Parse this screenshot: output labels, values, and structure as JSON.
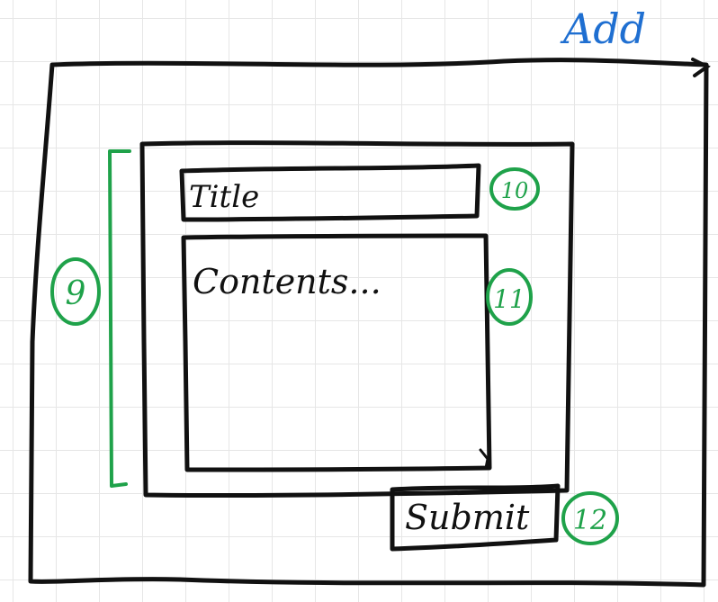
{
  "heading": "Add",
  "form": {
    "title_placeholder": "Title",
    "contents_placeholder": "Contents...",
    "submit_label": "Submit"
  },
  "annotations": {
    "form_group": "9",
    "title_field": "10",
    "contents_field": "11",
    "submit_button": "12"
  },
  "colors": {
    "ink": "#111111",
    "heading": "#1f6fd1",
    "annotation": "#1fa24a"
  }
}
